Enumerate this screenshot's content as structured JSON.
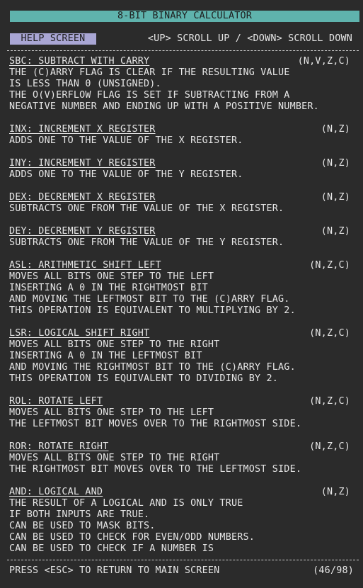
{
  "header": {
    "title": "8-BIT BINARY CALCULATOR",
    "screen_label": "HELP SCREEN",
    "scroll_hint": "<UP> SCROLL UP / <DOWN> SCROLL DOWN"
  },
  "sections": [
    {
      "heading": "SBC: SUBTRACT WITH CARRY",
      "flags": "(N,V,Z,C)",
      "lines": [
        "THE (C)ARRY FLAG IS CLEAR IF THE RESULTING VALUE",
        "IS LESS THAN 0 (UNSIGNED).",
        "THE O(V)ERFLOW FLAG IS SET IF SUBTRACTING FROM A",
        "NEGATIVE NUMBER AND ENDING UP WITH A POSITIVE NUMBER."
      ]
    },
    {
      "heading": "INX: INCREMENT X REGISTER",
      "flags": "(N,Z)",
      "lines": [
        "ADDS ONE TO THE VALUE OF THE X REGISTER."
      ]
    },
    {
      "heading": "INY: INCREMENT Y REGISTER",
      "flags": "(N,Z)",
      "lines": [
        "ADDS ONE TO THE VALUE OF THE Y REGISTER."
      ]
    },
    {
      "heading": "DEX: DECREMENT X REGISTER",
      "flags": "(N,Z)",
      "lines": [
        "SUBTRACTS ONE FROM THE VALUE OF THE X REGISTER."
      ]
    },
    {
      "heading": "DEY: DECREMENT Y REGISTER",
      "flags": "(N,Z)",
      "lines": [
        "SUBTRACTS ONE FROM THE VALUE OF THE Y REGISTER."
      ]
    },
    {
      "heading": "ASL: ARITHMETIC SHIFT LEFT",
      "flags": "(N,Z,C)",
      "lines": [
        "MOVES ALL BITS ONE STEP TO THE LEFT",
        "INSERTING A 0 IN THE RIGHTMOST BIT",
        "AND MOVING THE LEFTMOST BIT TO THE (C)ARRY FLAG.",
        "THIS OPERATION IS EQUIVALENT TO MULTIPLYING BY 2."
      ]
    },
    {
      "heading": "LSR: LOGICAL SHIFT RIGHT",
      "flags": "(N,Z,C)",
      "lines": [
        "MOVES ALL BITS ONE STEP TO THE RIGHT",
        "INSERTING A 0 IN THE LEFTMOST BIT",
        "AND MOVING THE RIGHTMOST BIT TO THE (C)ARRY FLAG.",
        "THIS OPERATION IS EQUIVALENT TO DIVIDING BY 2."
      ]
    },
    {
      "heading": "ROL: ROTATE LEFT",
      "flags": "(N,Z,C)",
      "lines": [
        "MOVES ALL BITS ONE STEP TO THE LEFT",
        "THE LEFTMOST BIT MOVES OVER TO THE RIGHTMOST SIDE."
      ]
    },
    {
      "heading": "ROR: ROTATE RIGHT",
      "flags": "(N,Z,C)",
      "lines": [
        "MOVES ALL BITS ONE STEP TO THE RIGHT",
        "THE RIGHTMOST BIT MOVES OVER TO THE LEFTMOST SIDE."
      ]
    },
    {
      "heading": "AND: LOGICAL AND",
      "flags": "(N,Z)",
      "lines": [
        "THE RESULT OF A LOGICAL AND IS ONLY TRUE",
        "IF BOTH INPUTS ARE TRUE.",
        "CAN BE USED TO MASK BITS.",
        "CAN BE USED TO CHECK FOR EVEN/ODD NUMBERS.",
        "CAN BE USED TO CHECK IF A NUMBER IS"
      ]
    }
  ],
  "footer": {
    "instruction": "PRESS <ESC> TO RETURN TO MAIN SCREEN",
    "page_indicator": "(46/98)"
  },
  "colors": {
    "background": "#2b2b2b",
    "text": "#e6e6e6",
    "title_bar": "#5fb3ad",
    "help_badge": "#a9a6d4"
  }
}
